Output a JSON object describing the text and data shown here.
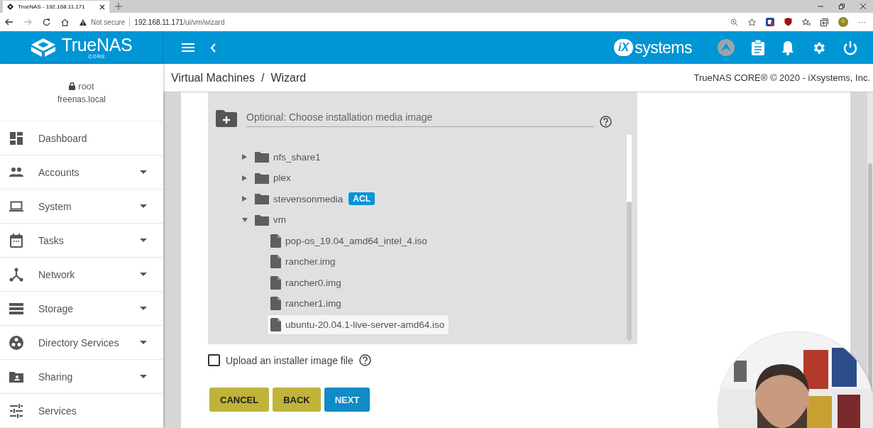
{
  "browser": {
    "tab_title": "TrueNAS - 192.168.11.171",
    "security": "Not secure",
    "url_host": "192.168.11.171",
    "url_path": "/ui/vm/wizard",
    "more": "···"
  },
  "header": {
    "logo": "TrueNAS",
    "logo_sub": "CORE",
    "brand_mark": "iX",
    "brand": "systems"
  },
  "user": {
    "name": "root",
    "host": "freenas.local"
  },
  "nav": [
    {
      "label": "Dashboard",
      "expandable": false
    },
    {
      "label": "Accounts",
      "expandable": true
    },
    {
      "label": "System",
      "expandable": true
    },
    {
      "label": "Tasks",
      "expandable": true
    },
    {
      "label": "Network",
      "expandable": true
    },
    {
      "label": "Storage",
      "expandable": true
    },
    {
      "label": "Directory Services",
      "expandable": true
    },
    {
      "label": "Sharing",
      "expandable": true
    },
    {
      "label": "Services",
      "expandable": false
    }
  ],
  "breadcrumb": [
    "Virtual Machines",
    "Wizard"
  ],
  "breadcrumb_separator": "/",
  "copyright": "TrueNAS CORE® © 2020 - iXsystems, Inc.",
  "media_field": {
    "placeholder": "Optional: Choose installation media image"
  },
  "tree": [
    {
      "name": "nfs_share1",
      "kind": "folder",
      "expanded": false,
      "selected": false
    },
    {
      "name": "plex",
      "kind": "folder",
      "expanded": false,
      "selected": false
    },
    {
      "name": "stevensonmedia",
      "kind": "folder",
      "expanded": false,
      "selected": false,
      "badge": "ACL"
    },
    {
      "name": "vm",
      "kind": "folder",
      "expanded": true,
      "selected": false,
      "children": [
        {
          "name": "pop-os_19.04_amd64_intel_4.iso",
          "kind": "file",
          "selected": false
        },
        {
          "name": "rancher.img",
          "kind": "file",
          "selected": false
        },
        {
          "name": "rancher0.img",
          "kind": "file",
          "selected": false
        },
        {
          "name": "rancher1.img",
          "kind": "file",
          "selected": false
        },
        {
          "name": "ubuntu-20.04.1-live-server-amd64.iso",
          "kind": "file",
          "selected": true
        }
      ]
    }
  ],
  "upload": {
    "label": "Upload an installer image file",
    "checked": false
  },
  "buttons": [
    {
      "label": "CANCEL",
      "kind": "secondary"
    },
    {
      "label": "BACK",
      "kind": "secondary"
    },
    {
      "label": "NEXT",
      "kind": "primary"
    }
  ],
  "webcam": {
    "kind": "picture"
  }
}
